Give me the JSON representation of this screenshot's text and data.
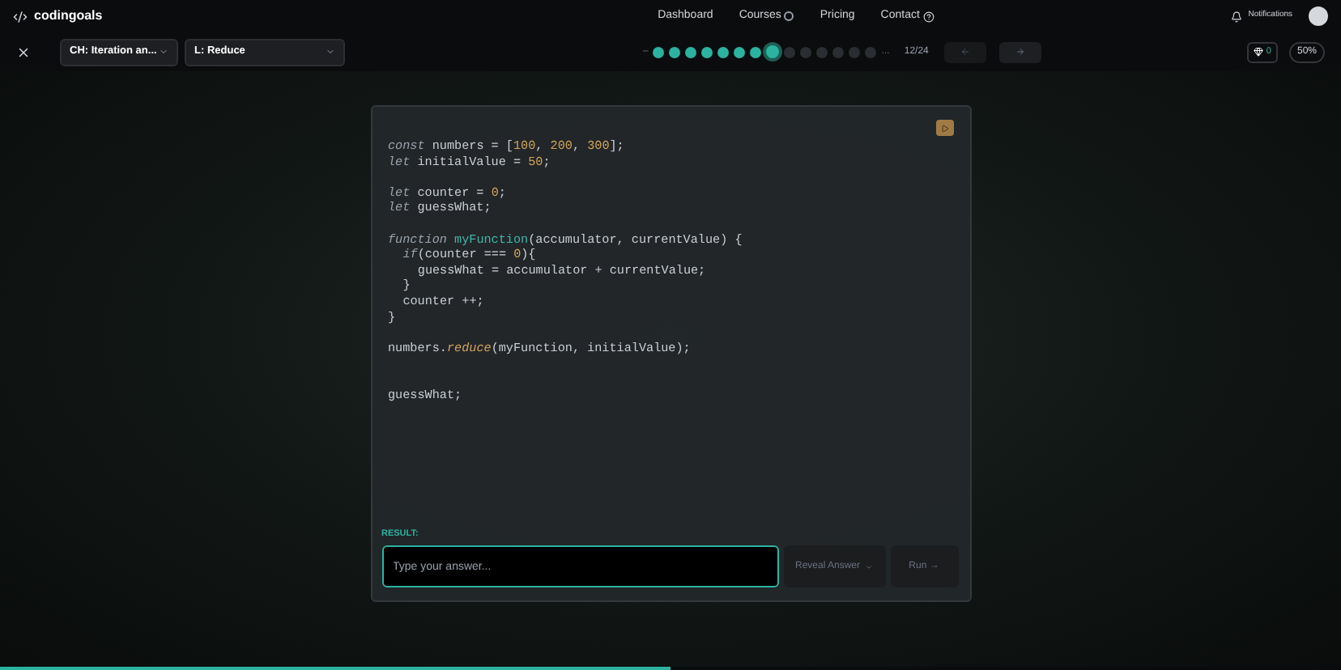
{
  "nav": {
    "brand": "codingoals",
    "links": [
      {
        "label": "Dashboard"
      },
      {
        "label": "Courses"
      },
      {
        "label": "Pricing"
      },
      {
        "label": "Contact"
      }
    ],
    "notifications": "Notifications"
  },
  "toolbar": {
    "chapter": "CH: Iteration an...",
    "lesson": "L: Reduce",
    "dots_lead": "–",
    "dots": [
      {
        "kind": "done"
      },
      {
        "kind": "done"
      },
      {
        "kind": "done"
      },
      {
        "kind": "done"
      },
      {
        "kind": "done"
      },
      {
        "kind": "done"
      },
      {
        "kind": "done"
      },
      {
        "kind": "current"
      },
      {
        "kind": "todo"
      },
      {
        "kind": "todo"
      },
      {
        "kind": "todo"
      },
      {
        "kind": "todo"
      },
      {
        "kind": "todo"
      },
      {
        "kind": "todo"
      }
    ],
    "dots_trail": "...",
    "count": "12/24",
    "gems": "0",
    "percent": "50%"
  },
  "code": {
    "lines": [
      {
        "kind": "plain",
        "tokens": [
          {
            "text": "const",
            "kind": "keyword"
          },
          {
            "text": " numbers = [",
            "kind": "plain"
          },
          {
            "text": "100",
            "kind": "number"
          },
          {
            "text": ", ",
            "kind": "plain"
          },
          {
            "text": "200",
            "kind": "number"
          },
          {
            "text": ", ",
            "kind": "plain"
          },
          {
            "text": "300",
            "kind": "number"
          },
          {
            "text": "];",
            "kind": "plain"
          }
        ]
      },
      {
        "kind": "plain",
        "tokens": [
          {
            "text": "let",
            "kind": "keyword"
          },
          {
            "text": " initialValue = ",
            "kind": "plain"
          },
          {
            "text": "50",
            "kind": "number"
          },
          {
            "text": ";",
            "kind": "plain"
          }
        ]
      },
      {
        "kind": "spaced",
        "tokens": [
          {
            "text": "let",
            "kind": "keyword"
          },
          {
            "text": " counter = ",
            "kind": "plain"
          },
          {
            "text": "0",
            "kind": "number"
          },
          {
            "text": ";",
            "kind": "plain"
          }
        ]
      },
      {
        "kind": "plain",
        "tokens": [
          {
            "text": "let",
            "kind": "keyword"
          },
          {
            "text": " guessWhat;",
            "kind": "plain"
          }
        ]
      },
      {
        "kind": "spaced",
        "tokens": [
          {
            "text": "function",
            "kind": "keyword"
          },
          {
            "text": " myFunction",
            "kind": "function"
          },
          {
            "text": "(accumulator, currentValue) {",
            "kind": "plain"
          }
        ],
        "children": [
          {
            "tokens": [
              {
                "text": "if",
                "kind": "keyword"
              },
              {
                "text": "(counter === ",
                "kind": "plain"
              },
              {
                "text": "0",
                "kind": "number"
              },
              {
                "text": "){",
                "kind": "plain"
              }
            ],
            "children": [
              {
                "tokens": [
                  {
                    "text": "guessWhat = accumulator + currentValue;",
                    "kind": "plain"
                  }
                ]
              }
            ]
          },
          {
            "tokens": [
              {
                "text": "}",
                "kind": "plain"
              }
            ]
          },
          {
            "tokens": [
              {
                "text": "counter ++;",
                "kind": "plain"
              }
            ]
          }
        ]
      },
      {
        "kind": "plain",
        "tokens": [
          {
            "text": "}",
            "kind": "plain"
          }
        ]
      },
      {
        "kind": "spaced",
        "tokens": [
          {
            "text": "numbers.",
            "kind": "plain"
          },
          {
            "text": "reduce",
            "kind": "method"
          },
          {
            "text": "(myFunction, initialValue);",
            "kind": "plain"
          }
        ]
      },
      {
        "kind": "wide_spaced",
        "tokens": [
          {
            "text": "guessWhat;",
            "kind": "plain"
          }
        ]
      }
    ]
  },
  "result": {
    "label": "RESULT:",
    "placeholder": "Type your answer...",
    "reveal": "Reveal Answer",
    "run": "Run →"
  },
  "progress": {
    "level": 0.5
  }
}
